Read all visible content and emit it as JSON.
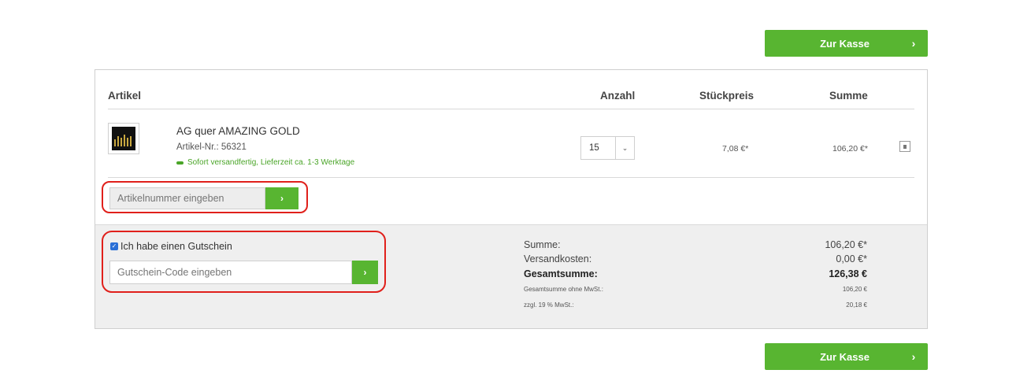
{
  "checkout": {
    "label": "Zur Kasse",
    "chevron": "›"
  },
  "table": {
    "headers": {
      "article": "Artikel",
      "quantity": "Anzahl",
      "unit_price": "Stückpreis",
      "total": "Summe"
    }
  },
  "item": {
    "name": "AG quer AMAZING GOLD",
    "article_number": "Artikel-Nr.: 56321",
    "shipping": "Sofort versandfertig, Lieferzeit ca. 1-3 Werktage",
    "quantity": "15",
    "unit_price": "7,08 €*",
    "line_total": "106,20 €*"
  },
  "article_entry": {
    "placeholder": "Artikelnummer eingeben",
    "button": "›"
  },
  "voucher": {
    "checkbox_label": "Ich habe einen Gutschein",
    "checked": true,
    "placeholder": "Gutschein-Code eingeben",
    "button": "›"
  },
  "summary": {
    "subtotal_label": "Summe:",
    "subtotal_value": "106,20 €*",
    "shipping_label": "Versandkosten:",
    "shipping_value": "0,00 €*",
    "total_label": "Gesamtsumme:",
    "total_value": "126,38 €",
    "net_label": "Gesamtsumme ohne MwSt.:",
    "net_value": "106,20 €",
    "vat_label": "zzgl. 19 % MwSt.:",
    "vat_value": "20,18 €"
  },
  "colors": {
    "accent": "#58b531",
    "highlight": "#e0201b",
    "shipping_text": "#4aa528",
    "panel_bg": "#efefef"
  }
}
